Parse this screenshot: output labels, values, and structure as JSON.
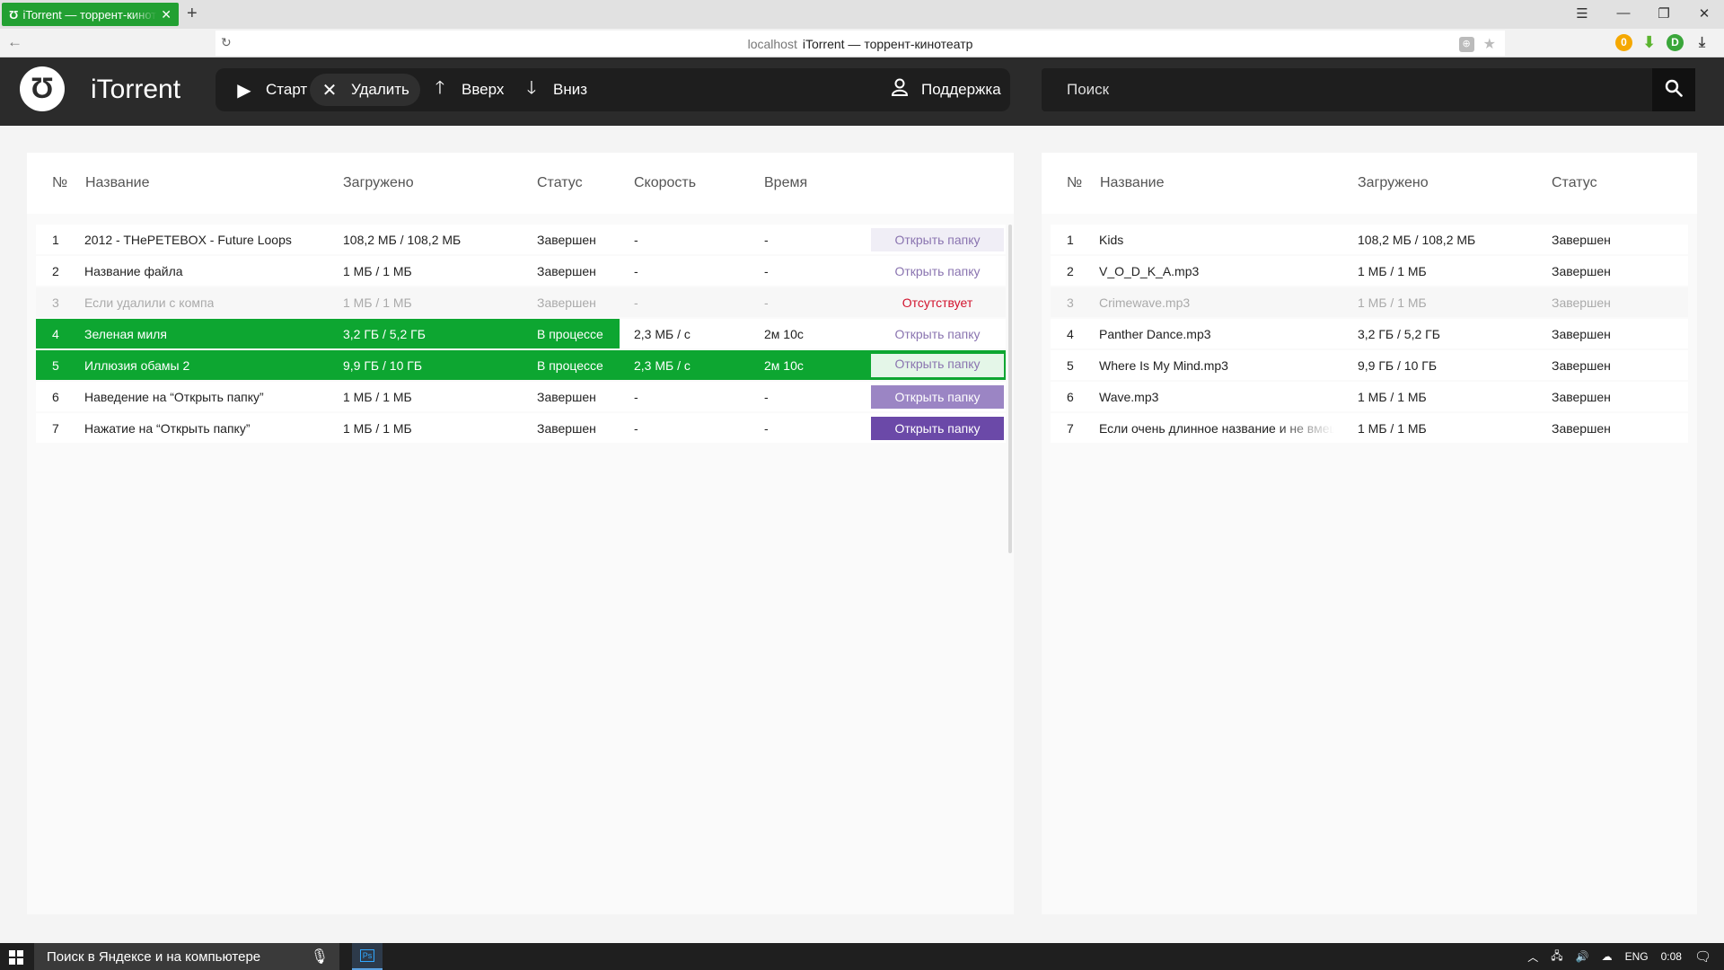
{
  "browser": {
    "tab_title": "iTorrent — торрент-кинотеатр",
    "new_tab_symbol": "+",
    "url_host": "localhost",
    "url_title": "iTorrent — торрент-кинотеатр"
  },
  "app": {
    "brand": "iTorrent",
    "toolbar": {
      "start_label": "Старт",
      "delete_label": "Удалить",
      "up_label": "Вверх",
      "down_label": "Вниз",
      "support_label": "Поддержка"
    },
    "search_placeholder": "Поиск"
  },
  "left_table": {
    "headers": {
      "num": "№",
      "name": "Название",
      "loaded": "Загружено",
      "status": "Статус",
      "speed": "Скорость",
      "time": "Время"
    },
    "rows": [
      {
        "num": "1",
        "name": "2012 - THePETEBOX - Future Loops",
        "loaded": "108,2 МБ / 108,2 МБ",
        "status": "Завершен",
        "speed": "-",
        "time": "-",
        "action": "Открыть папку"
      },
      {
        "num": "2",
        "name": "Название файла",
        "loaded": "1 МБ / 1 МБ",
        "status": "Завершен",
        "speed": "-",
        "time": "-",
        "action": "Открыть папку"
      },
      {
        "num": "3",
        "name": "Если удалили с компа",
        "loaded": "1 МБ / 1 МБ",
        "status": "Завершен",
        "speed": "-",
        "time": "-",
        "action": "Отсутствует"
      },
      {
        "num": "4",
        "name": "Зеленая миля",
        "loaded": "3,2 ГБ / 5,2 ГБ",
        "status": "В процессе",
        "speed": "2,3 МБ / с",
        "time": "2м 10с",
        "action": "Открыть папку"
      },
      {
        "num": "5",
        "name": "Иллюзия обамы 2",
        "loaded": "9,9 ГБ / 10 ГБ",
        "status": "В процессе",
        "speed": "2,3 МБ / с",
        "time": "2м 10с",
        "action": "Открыть папку"
      },
      {
        "num": "6",
        "name": "Наведение на “Открыть папку”",
        "loaded": "1 МБ / 1 МБ",
        "status": "Завершен",
        "speed": "-",
        "time": "-",
        "action": "Открыть папку"
      },
      {
        "num": "7",
        "name": "Нажатие на “Открыть папку”",
        "loaded": "1 МБ / 1 МБ",
        "status": "Завершен",
        "speed": "-",
        "time": "-",
        "action": "Открыть папку"
      }
    ]
  },
  "right_table": {
    "headers": {
      "num": "№",
      "name": "Название",
      "loaded": "Загружено",
      "status": "Статус"
    },
    "rows": [
      {
        "num": "1",
        "name": "Kids",
        "loaded": "108,2 МБ / 108,2 МБ",
        "status": "Завершен"
      },
      {
        "num": "2",
        "name": "V_O_D_K_A.mp3",
        "loaded": "1 МБ / 1 МБ",
        "status": "Завершен"
      },
      {
        "num": "3",
        "name": "Crimewave.mp3",
        "loaded": "1 МБ / 1 МБ",
        "status": "Завершен"
      },
      {
        "num": "4",
        "name": "Panther Dance.mp3",
        "loaded": "3,2 ГБ / 5,2 ГБ",
        "status": "Завершен"
      },
      {
        "num": "5",
        "name": "Where Is My Mind.mp3",
        "loaded": "9,9 ГБ / 10 ГБ",
        "status": "Завершен"
      },
      {
        "num": "6",
        "name": "Wave.mp3",
        "loaded": "1 МБ / 1 МБ",
        "status": "Завершен"
      },
      {
        "num": "7",
        "name": "Если очень длинное название и не вмещается",
        "loaded": "1 МБ / 1 МБ",
        "status": "Завершен"
      }
    ]
  },
  "taskbar": {
    "search_text": "Поиск в Яндексе и на компьютере",
    "lang": "ENG",
    "time": "0:08"
  },
  "colors": {
    "progress_green": "#0da631",
    "header_dark": "#2b2b2b",
    "missing_red": "#d2142e",
    "accent_purple": "#6b49a8"
  }
}
